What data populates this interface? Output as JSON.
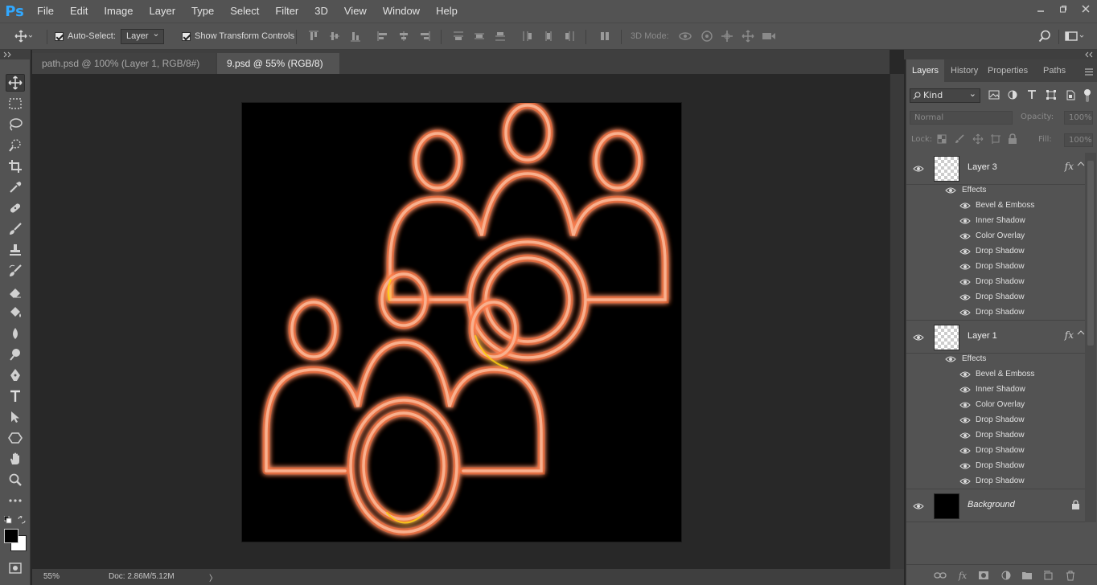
{
  "app": {
    "logo": "Ps"
  },
  "menu": [
    "File",
    "Edit",
    "Image",
    "Layer",
    "Type",
    "Select",
    "Filter",
    "3D",
    "View",
    "Window",
    "Help"
  ],
  "options": {
    "auto_select_label": "Auto-Select:",
    "auto_select_value": "Layer",
    "show_transform_label": "Show Transform Controls",
    "mode_3d_label": "3D Mode:"
  },
  "tabs": [
    {
      "label": "path.psd @ 100% (Layer 1, RGB/8#) *",
      "close": "×"
    },
    {
      "label": "9.psd @ 55% (RGB/8) *",
      "close": "×"
    }
  ],
  "status": {
    "zoom": "55%",
    "doc": "Doc: 2.86M/5.12M",
    "arrow": "〉"
  },
  "panel": {
    "tabs": [
      "Layers",
      "History",
      "Properties",
      "Paths"
    ],
    "kind_label": "Kind",
    "blend_mode": "Normal",
    "opacity_label": "Opacity:",
    "opacity_value": "100%",
    "lock_label": "Lock:",
    "fill_label": "Fill:",
    "fill_value": "100%"
  },
  "layers": [
    {
      "name": "Layer 3",
      "fx": "fx",
      "effects_label": "Effects",
      "effects": [
        "Bevel & Emboss",
        "Inner Shadow",
        "Color Overlay",
        "Drop Shadow",
        "Drop Shadow",
        "Drop Shadow",
        "Drop Shadow",
        "Drop Shadow"
      ]
    },
    {
      "name": "Layer 1",
      "fx": "fx",
      "effects_label": "Effects",
      "effects": [
        "Bevel & Emboss",
        "Inner Shadow",
        "Color Overlay",
        "Drop Shadow",
        "Drop Shadow",
        "Drop Shadow",
        "Drop Shadow",
        "Drop Shadow"
      ]
    },
    {
      "name": "Background"
    }
  ],
  "colors": {
    "ui_dark": "#535353",
    "canvas_bg": "#000000",
    "neon_core": "#f6a882",
    "neon_glow": "#ff7a3c",
    "accent_yellow": "#ffd200"
  }
}
